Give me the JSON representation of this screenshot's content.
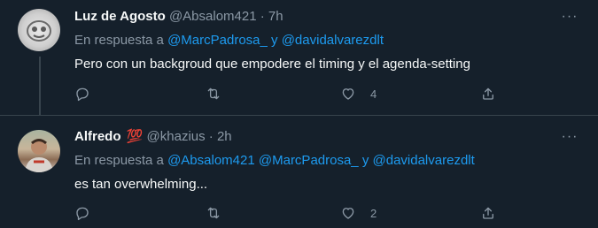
{
  "tweets": [
    {
      "name": "Luz de Agosto",
      "badge": "",
      "handle": "@Absalom421",
      "separator": "·",
      "time": "7h",
      "reply_prefix": "En respuesta a",
      "mentions": [
        "@MarcPadrosa_",
        "y",
        "@davidalvarezdlt"
      ],
      "text": "Pero con un backgroud que empodere el timing y el agenda-setting",
      "likes": "4",
      "more": "···"
    },
    {
      "name": "Alfredo",
      "badge": "💯",
      "handle": "@khazius",
      "separator": "·",
      "time": "2h",
      "reply_prefix": "En respuesta a",
      "mentions": [
        "@Absalom421",
        "@MarcPadrosa_",
        "y",
        "@davidalvarezdlt"
      ],
      "text": "es tan overwhelming...",
      "likes": "2",
      "more": "···"
    }
  ],
  "icons": {
    "reply": "reply-icon",
    "retweet": "retweet-icon",
    "like": "heart-icon",
    "share": "share-icon",
    "more": "more-icon"
  },
  "colors": {
    "background": "#15202b",
    "text": "#f7f9f9",
    "secondary": "#8b98a5",
    "link": "#1d9bf0",
    "divider": "#38444d"
  }
}
